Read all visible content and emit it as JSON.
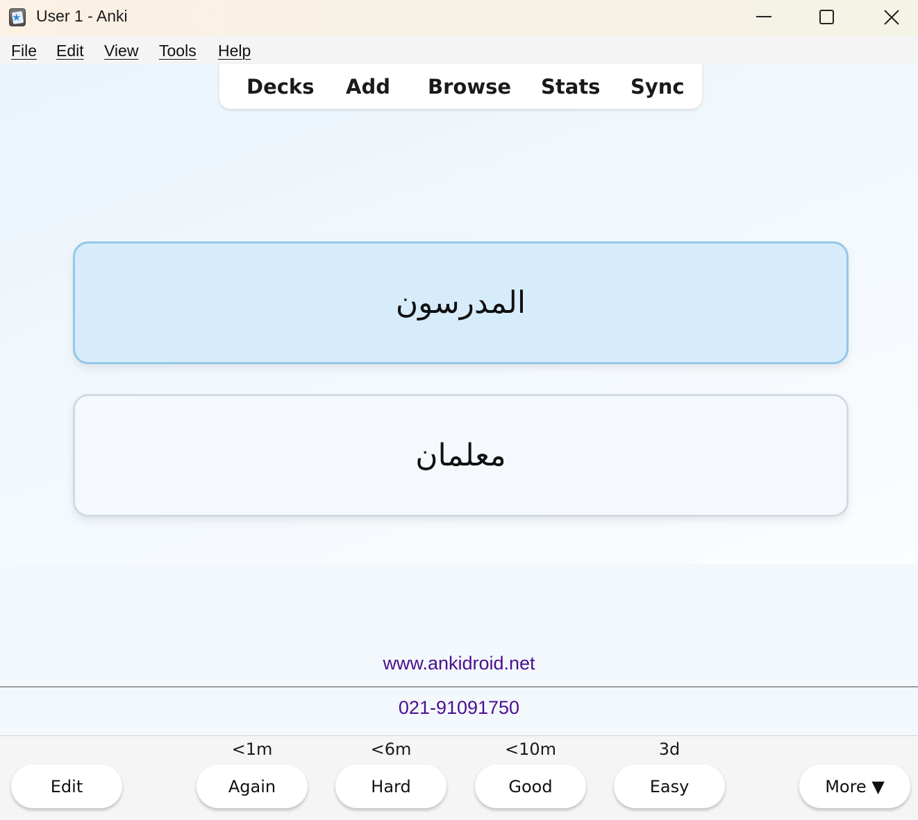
{
  "window": {
    "title": "User 1 - Anki",
    "icon": "anki-star-icon"
  },
  "menu": {
    "items": [
      {
        "label": "File"
      },
      {
        "label": "Edit"
      },
      {
        "label": "View"
      },
      {
        "label": "Tools"
      },
      {
        "label": "Help"
      }
    ]
  },
  "toolbar": {
    "items": [
      {
        "label": "Decks"
      },
      {
        "label": "Add"
      },
      {
        "label": "Browse"
      },
      {
        "label": "Stats"
      },
      {
        "label": "Sync"
      }
    ]
  },
  "cards": {
    "question": "المدرسون",
    "answer": "معلمان"
  },
  "footer": {
    "website": "www.ankidroid.net",
    "phone": "021-91091750"
  },
  "answer_bar": {
    "edit_label": "Edit",
    "more_label": "More ▼",
    "buttons": [
      {
        "label": "Again",
        "interval": "<1m"
      },
      {
        "label": "Hard",
        "interval": "<6m"
      },
      {
        "label": "Good",
        "interval": "<10m"
      },
      {
        "label": "Easy",
        "interval": "3d"
      }
    ]
  },
  "colors": {
    "question_card_bg": "#d6ecfb",
    "question_card_border": "#93c7e6",
    "answer_card_bg": "#f5f9fd",
    "answer_card_border": "#d2dbe2",
    "footer_text": "#4b0f8f"
  }
}
